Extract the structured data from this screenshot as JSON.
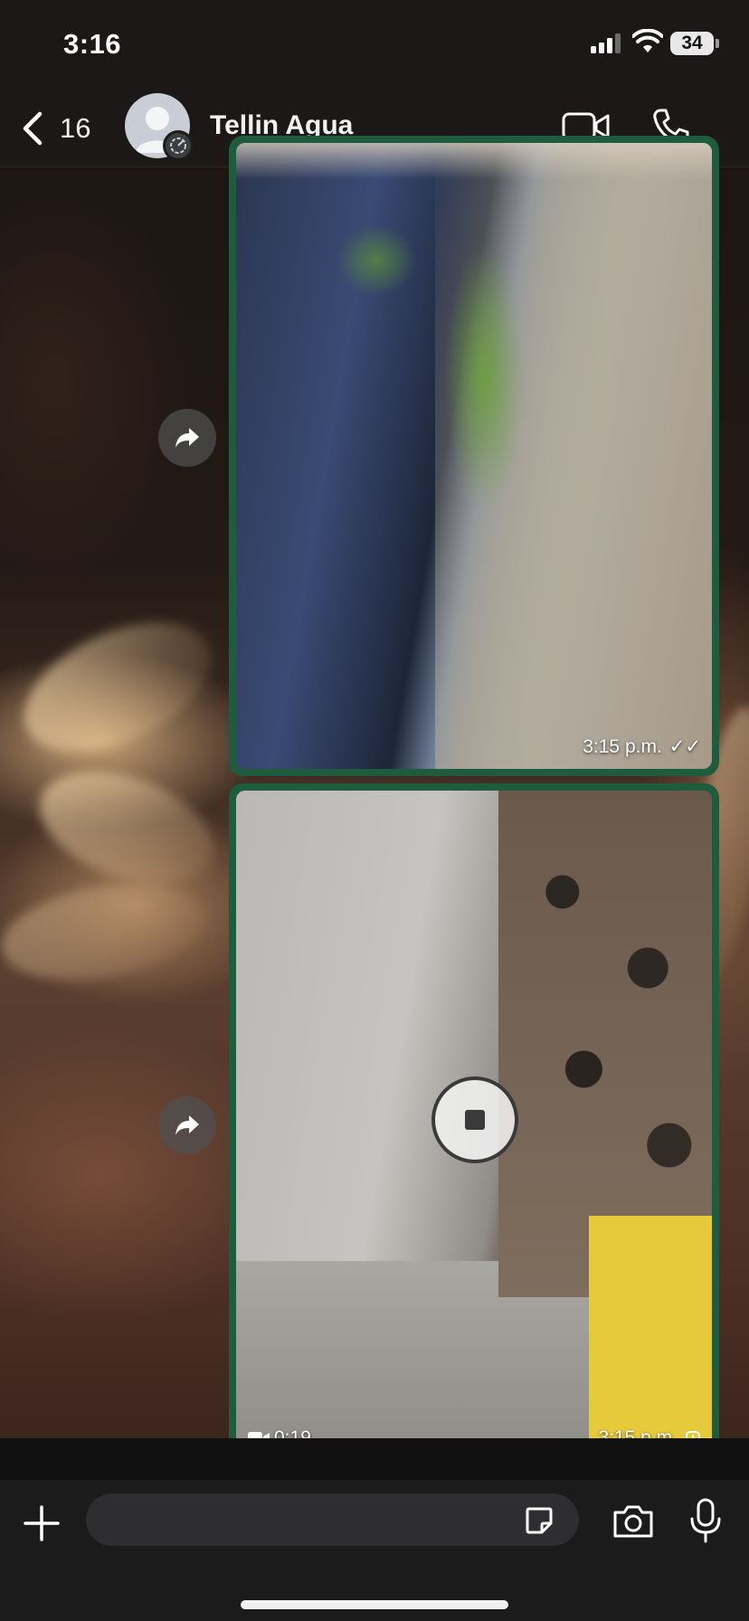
{
  "status_bar": {
    "time": "3:16",
    "battery": "34"
  },
  "header": {
    "back_count": "16",
    "contact_name": "Tellin Agua",
    "icons": [
      "chevron-left-icon",
      "avatar-icon",
      "video-call-icon",
      "phone-icon"
    ]
  },
  "messages": [
    {
      "type": "image",
      "description_icon": "photo",
      "time": "3:15 p.m.",
      "status": "✓✓"
    },
    {
      "type": "video",
      "duration": "0:19",
      "time": "3:15 p.m.",
      "status": "pending-clock"
    }
  ],
  "composer": {
    "placeholder": "",
    "icons": [
      "plus-icon",
      "sticker-icon",
      "camera-icon",
      "microphone-icon"
    ]
  },
  "colors": {
    "bubble": "#1f5b3d",
    "header_bg": "#1c1a19",
    "composer_bg": "#1b1b1c"
  }
}
